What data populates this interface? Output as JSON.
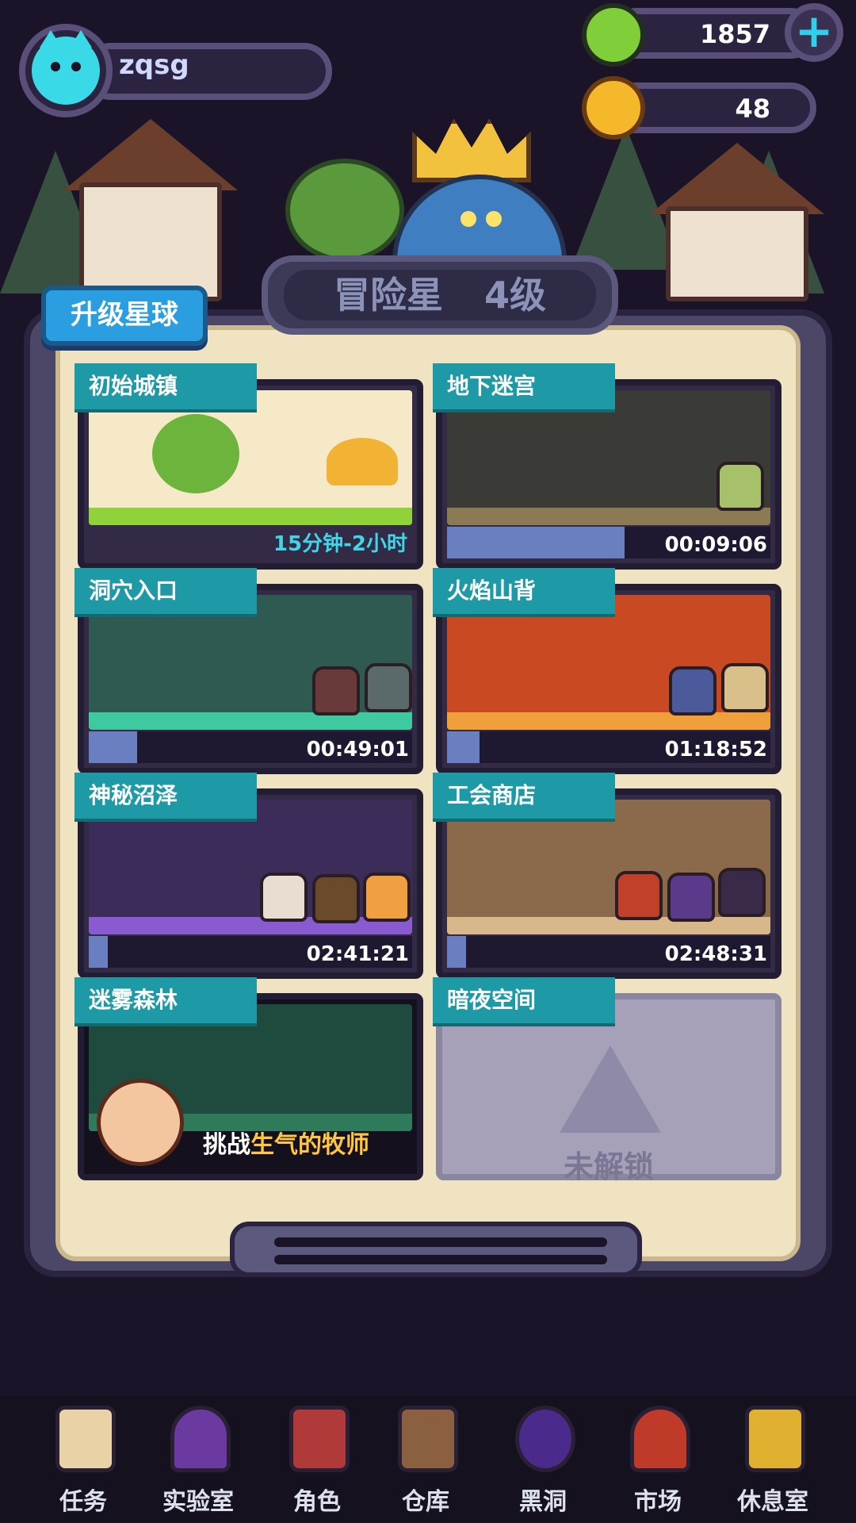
{
  "hud": {
    "username": "zqsg",
    "coins": "1857",
    "gems": "48"
  },
  "board": {
    "upgrade_button": "升级星球",
    "planet_name": "冒险星",
    "planet_level": "4级"
  },
  "levels": [
    {
      "name": "初始城镇",
      "duration": "15分钟-2小时"
    },
    {
      "name": "地下迷宫",
      "timer": "00:09:06",
      "progress": 0.55
    },
    {
      "name": "洞穴入口",
      "timer": "00:49:01",
      "progress": 0.15
    },
    {
      "name": "火焰山背",
      "timer": "01:18:52",
      "progress": 0.1
    },
    {
      "name": "神秘沼泽",
      "timer": "02:41:21",
      "progress": 0.06
    },
    {
      "name": "工会商店",
      "timer": "02:48:31",
      "progress": 0.06
    },
    {
      "name": "迷雾森林",
      "challenge_prefix": "挑战",
      "challenge_target": "生气的牧师"
    },
    {
      "name": "暗夜空间",
      "locked_text": "未解锁"
    }
  ],
  "nav": [
    {
      "label": "任务",
      "icon": "task-scroll-icon"
    },
    {
      "label": "实验室",
      "icon": "lab-icon"
    },
    {
      "label": "角色",
      "icon": "character-icon"
    },
    {
      "label": "仓库",
      "icon": "warehouse-chest-icon"
    },
    {
      "label": "黑洞",
      "icon": "black-hole-icon"
    },
    {
      "label": "市场",
      "icon": "market-icon"
    },
    {
      "label": "休息室",
      "icon": "lounge-icon"
    }
  ],
  "colors": {
    "accent_teal": "#1e9aa6",
    "timer_cyan": "#3fd6e8",
    "progress_fill": "#6a7fc0",
    "challenge_highlight": "#ffc640"
  }
}
